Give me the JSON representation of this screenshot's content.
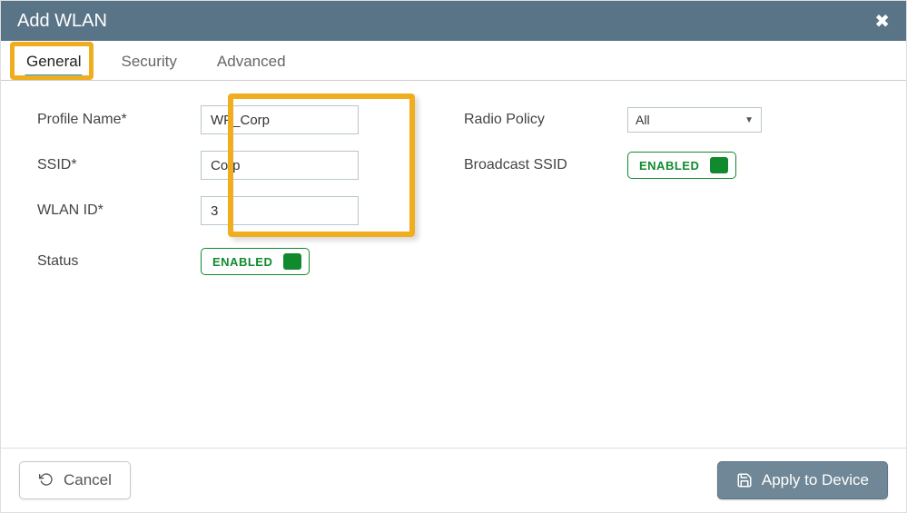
{
  "header": {
    "title": "Add WLAN"
  },
  "tabs": {
    "general": "General",
    "security": "Security",
    "advanced": "Advanced",
    "active": "general"
  },
  "form": {
    "labels": {
      "profile_name": "Profile Name*",
      "ssid": "SSID*",
      "wlan_id": "WLAN ID*",
      "status": "Status",
      "radio_policy": "Radio Policy",
      "broadcast_ssid": "Broadcast SSID"
    },
    "values": {
      "profile_name": "WP_Corp",
      "ssid": "Corp",
      "wlan_id": "3",
      "radio_policy": "All"
    },
    "toggles": {
      "status": "ENABLED",
      "broadcast_ssid": "ENABLED"
    }
  },
  "footer": {
    "cancel": "Cancel",
    "apply": "Apply to Device"
  },
  "colors": {
    "header_bg": "#5a7487",
    "highlight": "#f0ad1e",
    "tab_underline": "#1ba0e0",
    "enabled_green": "#118a2e"
  }
}
